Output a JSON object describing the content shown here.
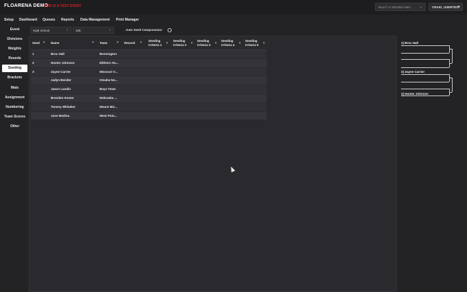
{
  "header": {
    "brand": "FLOARENA DEMO",
    "brand_sub": "THIS IS A TEST EVENT",
    "search_placeholder": "Bout # or Wrestler Nam",
    "user_label": "CRAIG_USERTEST"
  },
  "nav": {
    "items": [
      "Setup",
      "Dashboard",
      "Queues",
      "Reports",
      "Data Management",
      "Print Manager"
    ]
  },
  "sidebar": {
    "items": [
      "Event",
      "Divisions",
      "Weights",
      "Rounds",
      "Seeding",
      "Brackets",
      "Mats",
      "Assignment",
      "Numbering",
      "Team Scores",
      "Other"
    ],
    "active": "Seeding"
  },
  "filters": {
    "division": "High School",
    "weight": "106",
    "auto_seed_label": "Auto Seed Compression:"
  },
  "table": {
    "columns": [
      "Seed",
      "Name",
      "Team",
      "Record",
      "Seeding Criteria 1",
      "Seeding Criteria 2",
      "Seeding Criteria 3",
      "Seeding Criteria 4",
      "Seeding Criteria 5"
    ],
    "rows": [
      {
        "seed": "1",
        "name": "Broc Hall",
        "team": "Bennington",
        "record": ""
      },
      {
        "seed": "2",
        "name": "Hunter Johnson",
        "team": "Elkhorn So...",
        "record": ""
      },
      {
        "seed": "3",
        "name": "Zayne Carrier",
        "team": "Missouri V...",
        "record": ""
      },
      {
        "seed": "",
        "name": "Jadyn Bender",
        "team": "Omaha No...",
        "record": ""
      },
      {
        "seed": "",
        "name": "Jason Landin",
        "team": "Boys Town",
        "record": ""
      },
      {
        "seed": "",
        "name": "Brenden Kenter",
        "team": "Nebraska ...",
        "record": ""
      },
      {
        "seed": "",
        "name": "Tommy Whitaker",
        "team": "Mount Mic...",
        "record": ""
      },
      {
        "seed": "",
        "name": "Jose Medina",
        "team": "West Poin...",
        "record": ""
      }
    ]
  },
  "bracket": {
    "entries": [
      "1) Broc Hall",
      "3) Zayne Carrier",
      "2) Hunter Johnson"
    ]
  },
  "colors": {
    "accent_red": "#d01f1f",
    "background": "#232326"
  }
}
